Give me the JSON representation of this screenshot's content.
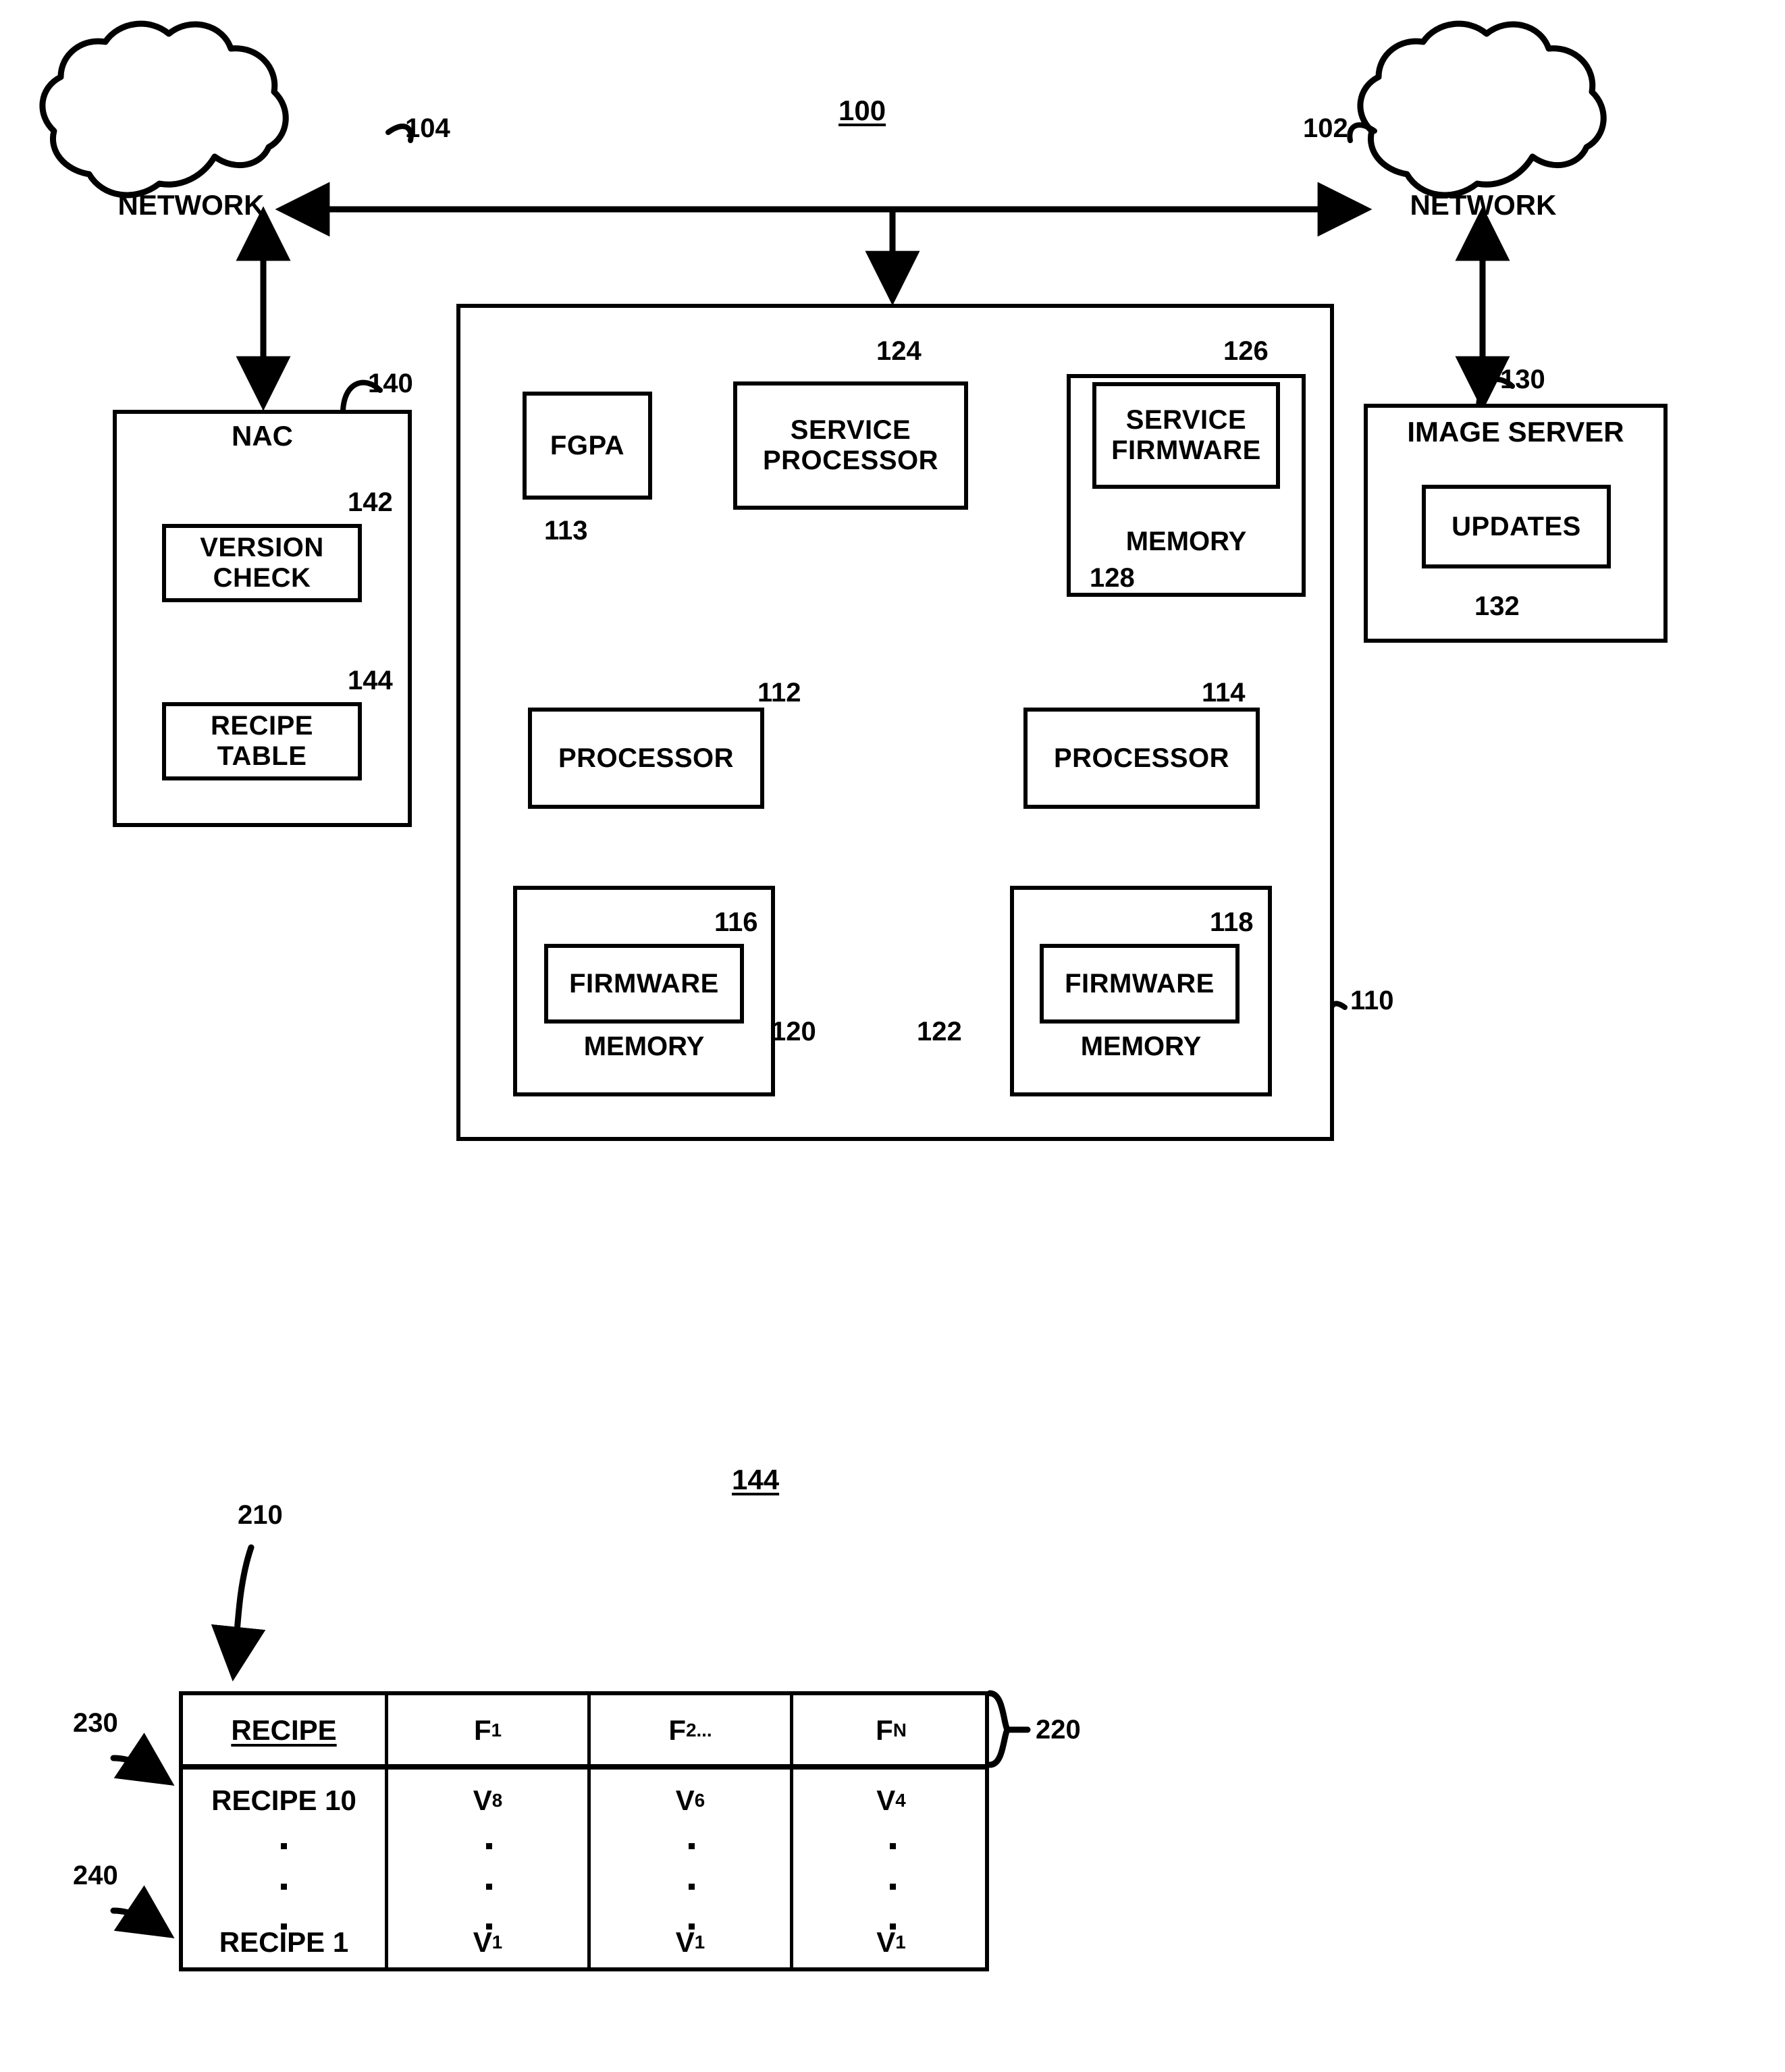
{
  "figure": {
    "system_ref": "100",
    "table_ref": "144"
  },
  "clouds": [
    {
      "name": "network-left",
      "label": "NETWORK",
      "ref": "104"
    },
    {
      "name": "network-right",
      "label": "NETWORK",
      "ref": "102"
    }
  ],
  "nac": {
    "title": "NAC",
    "ref": "140",
    "blocks": [
      {
        "label": "VERSION CHECK",
        "line1": "VERSION",
        "line2": "CHECK",
        "ref": "142"
      },
      {
        "label": "RECIPE TABLE",
        "line1": "RECIPE",
        "line2": "TABLE",
        "ref": "144"
      }
    ]
  },
  "system": {
    "ref": "110",
    "blocks": [
      {
        "name": "fgpa",
        "label": "FGPA",
        "ref": "113"
      },
      {
        "name": "service-processor",
        "line1": "SERVICE",
        "line2": "PROCESSOR",
        "ref": "124"
      },
      {
        "name": "service-firmware",
        "line1": "SERVICE",
        "line2": "FIRMWARE",
        "ref": "126"
      },
      {
        "name": "service-firmware-memory",
        "label": "MEMORY",
        "ref": "128"
      },
      {
        "name": "processor-left",
        "label": "PROCESSOR",
        "ref": "112"
      },
      {
        "name": "processor-right",
        "label": "PROCESSOR",
        "ref": "114"
      },
      {
        "name": "firmware-left",
        "label": "FIRMWARE",
        "ref": "116"
      },
      {
        "name": "memory-left",
        "label": "MEMORY",
        "ref": "120"
      },
      {
        "name": "firmware-right",
        "label": "FIRMWARE",
        "ref": "118"
      },
      {
        "name": "memory-right",
        "label": "MEMORY",
        "ref": "122"
      }
    ]
  },
  "image_server": {
    "title": "IMAGE SERVER",
    "ref": "130",
    "updates_label": "UPDATES",
    "updates_ref": "132"
  },
  "recipe_table": {
    "ref": "144",
    "header_ref": "210",
    "header_row_ref": "220",
    "first_row_ref": "230",
    "last_row_ref": "240",
    "headers": [
      "RECIPE",
      "F₁",
      "F₂...",
      "Fₙ"
    ],
    "header_base": [
      "RECIPE",
      "F",
      "F",
      "F"
    ],
    "header_sub": [
      "",
      "1",
      "2...",
      "N"
    ],
    "rows": [
      {
        "recipe": "RECIPE 10",
        "values_base": [
          "V",
          "V",
          "V"
        ],
        "values_sub": [
          "8",
          "6",
          "4"
        ]
      },
      {
        "recipe": "RECIPE 1",
        "values_base": [
          "V",
          "V",
          "V"
        ],
        "values_sub": [
          "1",
          "1",
          "1"
        ]
      }
    ],
    "ellipsis": "vertical-dots"
  },
  "colors": {
    "ink": "#000000",
    "paper": "#ffffff"
  }
}
